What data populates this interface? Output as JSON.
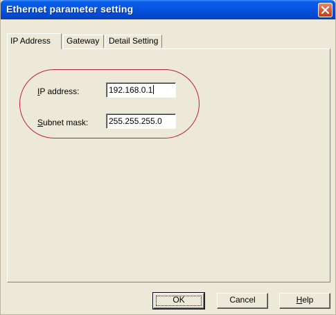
{
  "window": {
    "title": "Ethernet parameter setting",
    "close_icon": "close-icon"
  },
  "tabs": [
    {
      "label": "IP Address",
      "active": true
    },
    {
      "label": "Gateway",
      "active": false
    },
    {
      "label": "Detail Setting",
      "active": false
    }
  ],
  "ip_tab": {
    "ip_label_key": "I",
    "ip_label_rest": "P address:",
    "ip_value": "192.168.0.1",
    "subnet_label_key": "S",
    "subnet_label_rest": "ubnet mask:",
    "subnet_value": "255.255.255.0"
  },
  "buttons": {
    "ok": "OK",
    "cancel": "Cancel",
    "help_key": "H",
    "help_rest": "elp"
  },
  "colors": {
    "highlight": "#c0203a",
    "titlebar": "#0553e0",
    "background": "#ece9d8"
  }
}
